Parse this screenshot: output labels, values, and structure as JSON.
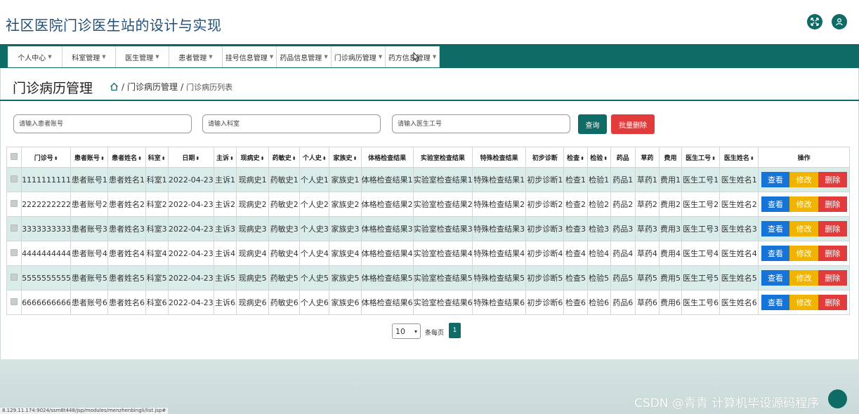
{
  "app": {
    "title": "社区医院门诊医生站的设计与实现"
  },
  "nav": {
    "items": [
      {
        "label": "个人中心"
      },
      {
        "label": "科室管理"
      },
      {
        "label": "医生管理"
      },
      {
        "label": "患者管理"
      },
      {
        "label": "挂号信息管理"
      },
      {
        "label": "药品信息管理"
      },
      {
        "label": "门诊病历管理"
      },
      {
        "label": "药方信息管理"
      }
    ]
  },
  "page": {
    "title": "门诊病历管理",
    "breadcrumb": {
      "sep": "/",
      "items": [
        "门诊病历管理",
        "门诊病历列表"
      ]
    }
  },
  "filters": {
    "patient_account_placeholder": "请输入患者账号",
    "department_placeholder": "请输入科室",
    "doctor_id_placeholder": "请输入医生工号",
    "search_label": "查询",
    "batch_delete_label": "批量删除"
  },
  "table": {
    "headers": [
      "门诊号",
      "患者账号",
      "患者姓名",
      "科室",
      "日期",
      "主诉",
      "现病史",
      "药敏史",
      "个人史",
      "家族史",
      "体格检查结果",
      "实验室检查结果",
      "特殊检查结果",
      "初步诊断",
      "检查",
      "检验",
      "药品",
      "草药",
      "费用",
      "医生工号",
      "医生姓名",
      "操作"
    ],
    "rows": [
      [
        "1111111111",
        "患者账号1",
        "患者姓名1",
        "科室1",
        "2022-04-23",
        "主诉1",
        "现病史1",
        "药敏史1",
        "个人史1",
        "家族史1",
        "体格检查结果1",
        "实验室检查结果1",
        "特殊检查结果1",
        "初步诊断1",
        "检查1",
        "检验1",
        "药品1",
        "草药1",
        "费用1",
        "医生工号1",
        "医生姓名1"
      ],
      [
        "2222222222",
        "患者账号2",
        "患者姓名2",
        "科室2",
        "2022-04-23",
        "主诉2",
        "现病史2",
        "药敏史2",
        "个人史2",
        "家族史2",
        "体格检查结果2",
        "实验室检查结果2",
        "特殊检查结果2",
        "初步诊断2",
        "检查2",
        "检验2",
        "药品2",
        "草药2",
        "费用2",
        "医生工号2",
        "医生姓名2"
      ],
      [
        "3333333333",
        "患者账号3",
        "患者姓名3",
        "科室3",
        "2022-04-23",
        "主诉3",
        "现病史3",
        "药敏史3",
        "个人史3",
        "家族史3",
        "体格检查结果3",
        "实验室检查结果3",
        "特殊检查结果3",
        "初步诊断3",
        "检查3",
        "检验3",
        "药品3",
        "草药3",
        "费用3",
        "医生工号3",
        "医生姓名3"
      ],
      [
        "4444444444",
        "患者账号4",
        "患者姓名4",
        "科室4",
        "2022-04-23",
        "主诉4",
        "现病史4",
        "药敏史4",
        "个人史4",
        "家族史4",
        "体格检查结果4",
        "实验室检查结果4",
        "特殊检查结果4",
        "初步诊断4",
        "检查4",
        "检验4",
        "药品4",
        "草药4",
        "费用4",
        "医生工号4",
        "医生姓名4"
      ],
      [
        "5555555555",
        "患者账号5",
        "患者姓名5",
        "科室5",
        "2022-04-23",
        "主诉5",
        "现病史5",
        "药敏史5",
        "个人史5",
        "家族史5",
        "体格检查结果5",
        "实验室检查结果5",
        "特殊检查结果5",
        "初步诊断5",
        "检查5",
        "检验5",
        "药品5",
        "草药5",
        "费用5",
        "医生工号5",
        "医生姓名5"
      ],
      [
        "6666666666",
        "患者账号6",
        "患者姓名6",
        "科室6",
        "2022-04-23",
        "主诉6",
        "现病史6",
        "药敏史6",
        "个人史6",
        "家族史6",
        "体格检查结果6",
        "实验室检查结果6",
        "特殊检查结果6",
        "初步诊断6",
        "检查6",
        "检验6",
        "药品6",
        "草药6",
        "费用6",
        "医生工号6",
        "医生姓名6"
      ]
    ],
    "actions": {
      "view": "查看",
      "edit": "修改",
      "delete": "删除"
    }
  },
  "pagination": {
    "page_size": "10",
    "per_page_label": "条每页",
    "current_page": "1"
  },
  "status_bar": {
    "url": "8.129.11.174:9024/ssm8t448/jsp/modules/menzhenbingli/list.jsp#"
  },
  "watermark": "CSDN @青青  计算机毕设源码程序",
  "colors": {
    "primary": "#0e6b66",
    "row_alt": "#d9ecea",
    "view": "#1673d8",
    "edit": "#f0b400",
    "delete": "#e23b3b",
    "batch_delete": "#e23b3b",
    "title": "#1f4f78"
  },
  "icons": {
    "fullscreen": "expand-arrows-icon",
    "user": "user-avatar-icon",
    "home": "home-icon"
  }
}
